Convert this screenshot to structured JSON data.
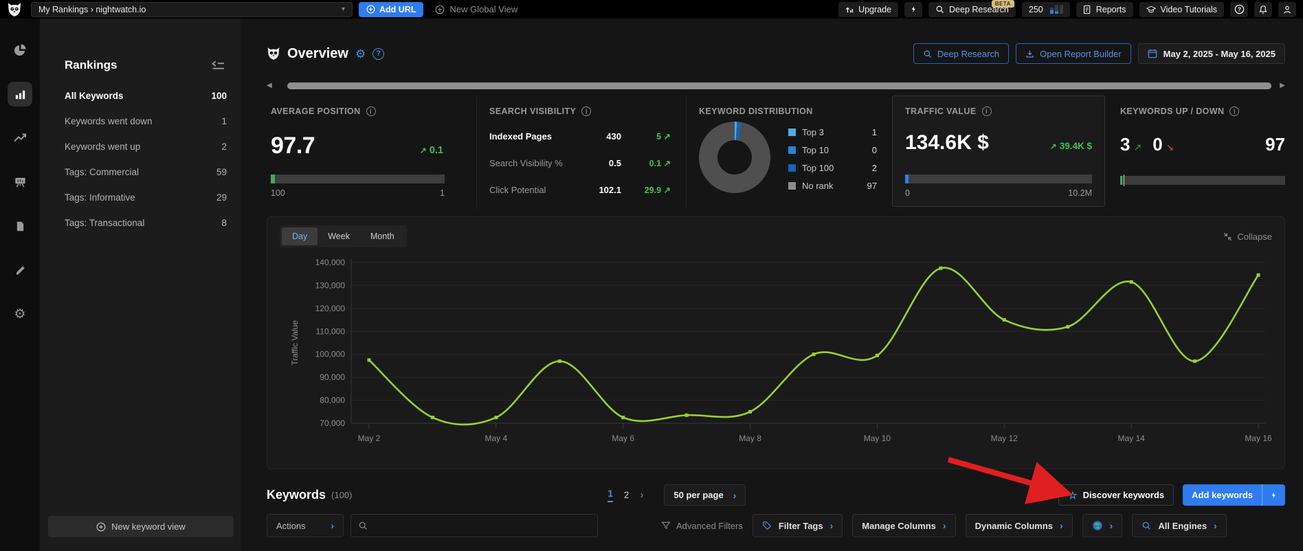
{
  "colors": {
    "accent": "#2e7cf0",
    "green": "#3ec052",
    "red": "#d84040",
    "line": "#97d132"
  },
  "icons": {
    "trend_up": "↗",
    "trend_down": "↘",
    "chevron_down": "▾",
    "chevron_right": "›",
    "page_next": "›",
    "star": "☆",
    "scroll_left": "◀",
    "scroll_right": "▶",
    "gear": "⚙",
    "question": "?",
    "info": "i"
  },
  "topbar": {
    "project": "My Rankings › nightwatch.io",
    "add_url": "Add URL",
    "new_global_view": "New Global View",
    "upgrade": "Upgrade",
    "deep_research": "Deep Research",
    "beta": "BETA",
    "usage": "250",
    "reports": "Reports",
    "video_tutorials": "Video Tutorials"
  },
  "rankings": {
    "title": "Rankings",
    "items": [
      {
        "label": "All Keywords",
        "count": "100"
      },
      {
        "label": "Keywords went down",
        "count": "1"
      },
      {
        "label": "Keywords went up",
        "count": "2"
      },
      {
        "label": "Tags: Commercial",
        "count": "59"
      },
      {
        "label": "Tags: Informative",
        "count": "29"
      },
      {
        "label": "Tags: Transactional",
        "count": "8"
      }
    ],
    "new_keyword_view": "New keyword view"
  },
  "overview": {
    "title": "Overview",
    "deep_research": "Deep Research",
    "open_report_builder": "Open Report Builder",
    "date_range": "May 2, 2025 - May 16, 2025"
  },
  "cards": {
    "average_position": {
      "title": "AVERAGE POSITION",
      "value": "97.7",
      "change": "0.1",
      "scale_left": "100",
      "scale_right": "1"
    },
    "search_visibility": {
      "title": "SEARCH VISIBILITY",
      "rows": [
        {
          "label": "Indexed Pages",
          "value": "430",
          "change": "5"
        },
        {
          "label": "Search Visibility %",
          "value": "0.5",
          "change": "0.1"
        },
        {
          "label": "Click Potential",
          "value": "102.1",
          "change": "29.9"
        }
      ]
    },
    "keyword_distribution": {
      "title": "KEYWORD DISTRIBUTION",
      "legend": [
        {
          "label": "Top 3",
          "value": "1",
          "color": "#53a9e8"
        },
        {
          "label": "Top 10",
          "value": "0",
          "color": "#2186d6"
        },
        {
          "label": "Top 100",
          "value": "2",
          "color": "#1763b8"
        },
        {
          "label": "No rank",
          "value": "97",
          "color": "#8c8c8c"
        }
      ]
    },
    "traffic_value": {
      "title": "TRAFFIC VALUE",
      "value": "134.6K $",
      "change": "39.4K $",
      "scale_left": "0",
      "scale_right": "10.2M"
    },
    "keywords_up_down": {
      "title": "KEYWORDS UP / DOWN",
      "up": "3",
      "down": "0",
      "no_change": "97"
    }
  },
  "donut": {
    "segments": [
      {
        "label": "Top 3",
        "value": 1,
        "color": "#53a9e8"
      },
      {
        "label": "Top 10",
        "value": 0,
        "color": "#2186d6"
      },
      {
        "label": "Top 100",
        "value": 2,
        "color": "#1763b8"
      },
      {
        "label": "No rank",
        "value": 97,
        "color": "#4f4f4f"
      }
    ]
  },
  "chart": {
    "tabs": [
      "Day",
      "Week",
      "Month"
    ],
    "active_tab": "Day",
    "collapse": "Collapse"
  },
  "chart_data": {
    "type": "line",
    "title": "",
    "xlabel": "",
    "ylabel": "Traffic Value",
    "x": [
      "May 2",
      "May 3",
      "May 4",
      "May 5",
      "May 6",
      "May 7",
      "May 8",
      "May 9",
      "May 10",
      "May 11",
      "May 12",
      "May 13",
      "May 14",
      "May 15",
      "May 16"
    ],
    "x_tick_labels": [
      "May 2",
      "May 4",
      "May 6",
      "May 8",
      "May 10",
      "May 12",
      "May 14",
      "May 16"
    ],
    "series": [
      {
        "name": "Traffic Value",
        "color": "#97d132",
        "values": [
          97500,
          72500,
          72500,
          97000,
          72500,
          73500,
          75000,
          100000,
          99500,
          137500,
          115000,
          112000,
          131500,
          97000,
          134500
        ]
      }
    ],
    "ylim": [
      70000,
      140000
    ],
    "ytick_step": 10000,
    "grid": true,
    "legend": false
  },
  "keywords": {
    "title": "Keywords",
    "count": "(100)",
    "pages": [
      "1",
      "2"
    ],
    "per_page": "50 per page",
    "discover": "Discover keywords",
    "add": "Add keywords",
    "toolbar": {
      "actions": "Actions",
      "search_placeholder": "",
      "advanced_filters": "Advanced Filters",
      "filter_tags": "Filter Tags",
      "manage_columns": "Manage Columns",
      "dynamic_columns": "Dynamic Columns",
      "all_engines": "All Engines"
    }
  }
}
